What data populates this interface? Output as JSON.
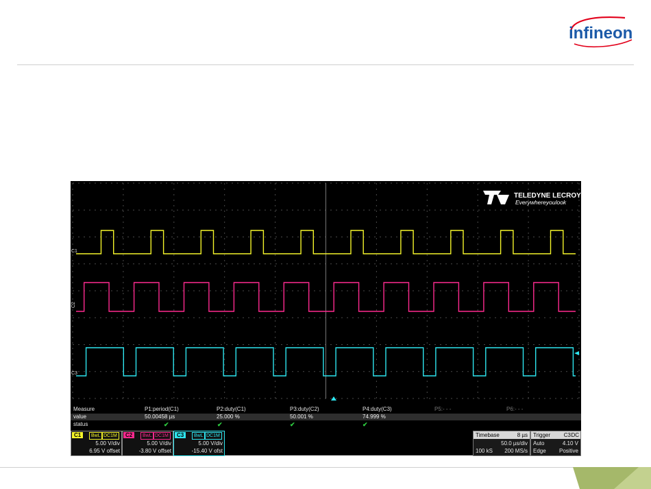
{
  "brand": {
    "name": "infineon"
  },
  "scope": {
    "vendor": {
      "name": "TELEDYNE LECROY",
      "tagline": "Everywhereyoulook"
    },
    "trace_labels": [
      "C1",
      "C2",
      "C3"
    ],
    "measure": {
      "header": [
        "Measure",
        "P1:period(C1)",
        "P2:duty(C1)",
        "P3:duty(C2)",
        "P4:duty(C3)",
        "P5:- - -",
        "P6:- - -"
      ],
      "value_label": "value",
      "values": [
        "50.00458 µs",
        "25.000 %",
        "50.001 %",
        "74.999 %"
      ],
      "status_label": "status",
      "status_mark": "✔"
    },
    "channels": [
      {
        "tag": "C1",
        "flags": [
          "BwL",
          "DC1M"
        ],
        "vdiv": "5.00 V/div",
        "offset": "6.95 V offset",
        "color": "#f5f52a"
      },
      {
        "tag": "C2",
        "flags": [
          "BwL",
          "DC1M"
        ],
        "vdiv": "5.00 V/div",
        "offset": "-3.80 V offset",
        "color": "#ff2a90"
      },
      {
        "tag": "C3",
        "flags": [
          "BwL",
          "DC1M"
        ],
        "vdiv": "5.00 V/div",
        "offset": "-15.40 V ofst",
        "color": "#2ee6f0"
      }
    ],
    "timebase": {
      "label": "Timebase",
      "delay": "8 µs",
      "div": "50.0 µs/div",
      "samples": "100 kS",
      "rate": "200 MS/s"
    },
    "trigger": {
      "label": "Trigger",
      "source": "C3",
      "coupling": "DC",
      "mode": "Auto",
      "level": "4.10 V",
      "type": "Edge",
      "slope": "Positive"
    }
  },
  "waveforms": {
    "period_us": 50.0,
    "time_span_us": 500,
    "duty": [
      0.25,
      0.5,
      0.75
    ],
    "phase_us": [
      25.0,
      8.0,
      10.0
    ]
  },
  "colors": {
    "c1": "#f5f52a",
    "c2": "#ff2a90",
    "c3": "#2ee6f0",
    "brand_red": "#e2001a",
    "brand_blue": "#1c5aa8",
    "deco_green": "#a5b86a"
  }
}
